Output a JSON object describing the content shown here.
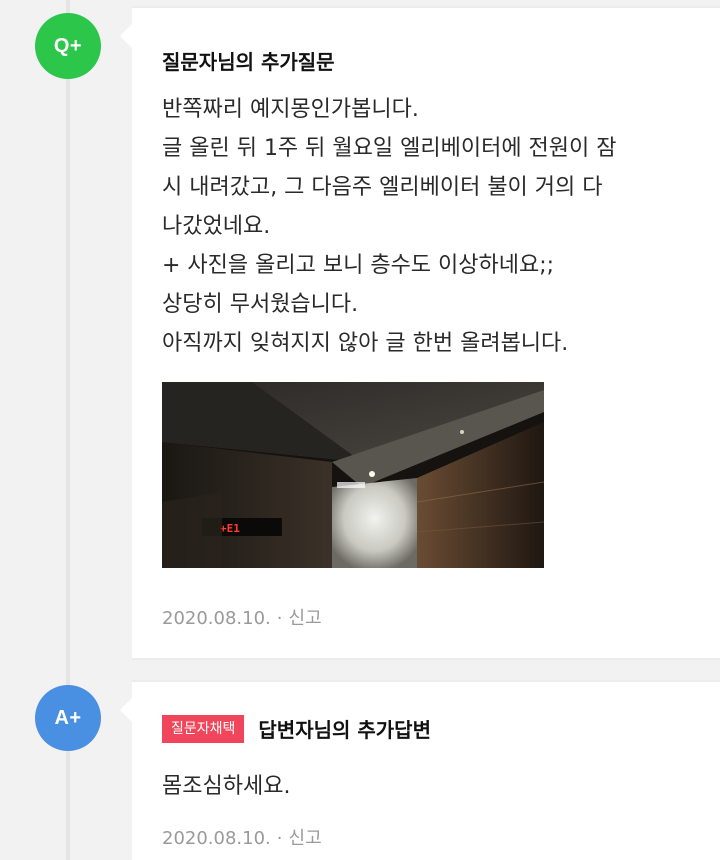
{
  "question_followup": {
    "badge": "Q+",
    "title": "질문자님의 추가질문",
    "lines": [
      "반쪽짜리 예지몽인가봅니다.",
      "글 올린 뒤 1주 뒤 월요일 엘리베이터에 전원이 잠",
      "시 내려갔고, 그 다음주 엘리베이터 불이 거의 다",
      "나갔었네요.",
      "+ 사진을 올리고 보니 층수도 이상하네요;;",
      "상당히 무서웠습니다.",
      "아직까지 잊혀지지 않아 글 한번 올려봅니다."
    ],
    "photo_display_text": "+E1",
    "date": "2020.08.10.",
    "separator": "·",
    "report_label": "신고"
  },
  "answer_followup": {
    "badge": "A+",
    "tag": "질문자채택",
    "title": "답변자님의 추가답변",
    "body": "몸조심하세요.",
    "date": "2020.08.10.",
    "separator": "·",
    "report_label": "신고"
  },
  "colors": {
    "question_badge": "#2bc64a",
    "answer_badge": "#4a90e2",
    "chosen_tag": "#f0455b"
  }
}
